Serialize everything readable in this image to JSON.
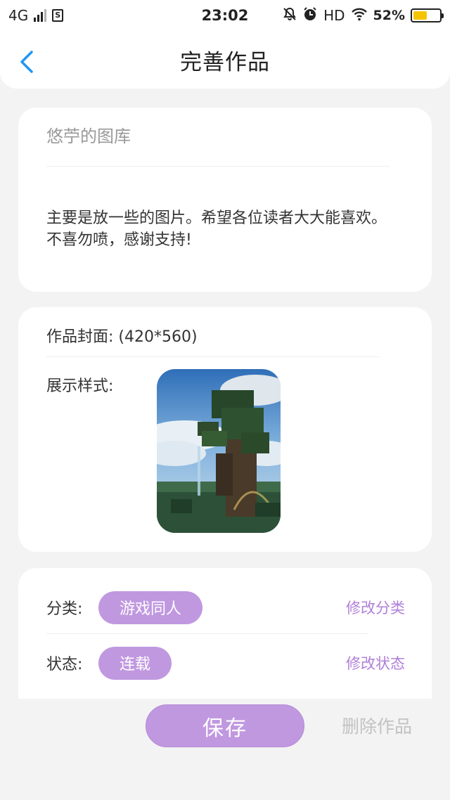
{
  "status_bar": {
    "network": "4G",
    "sim_label": "S",
    "time": "23:02",
    "hd": "HD",
    "battery": "52%",
    "battery_level": 0.52,
    "icons": [
      "signal-icon",
      "sim-icon",
      "mute-bell-icon",
      "alarm-icon",
      "wifi-icon",
      "battery-icon"
    ]
  },
  "header": {
    "title": "完善作品",
    "back_icon": "chevron-left-icon",
    "accent": "#2196f3"
  },
  "intro": {
    "title_value": "悠苧的图库",
    "description": "主要是放一些的图片。希望各位读者大大能喜欢。不喜勿喷，感谢支持!"
  },
  "cover": {
    "label": "作品封面: (420*560)",
    "style_label": "展示样式:"
  },
  "meta": {
    "category_label": "分类:",
    "category_value": "游戏同人",
    "category_edit": "修改分类",
    "status_label": "状态:",
    "status_value": "连载",
    "status_edit": "修改状态"
  },
  "actions": {
    "save_label": "保存",
    "delete_label": "删除作品"
  },
  "colors": {
    "tag": "#c098e0",
    "edit_link": "#b07fd8",
    "page_bg": "#f3f3f3"
  }
}
